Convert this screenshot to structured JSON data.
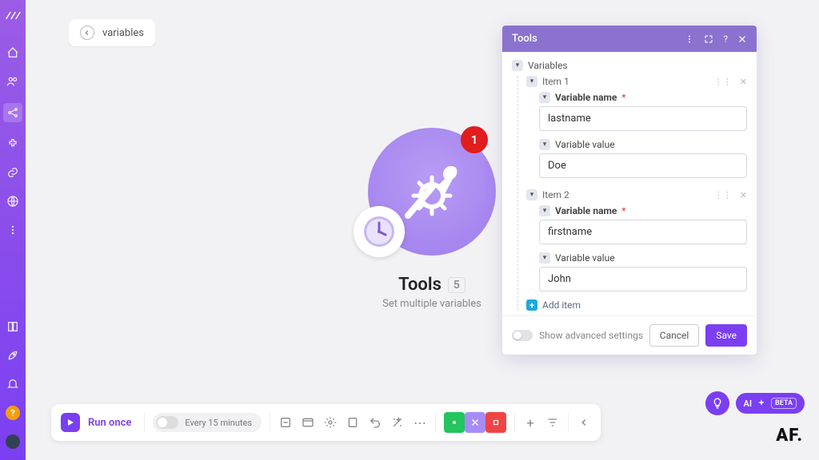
{
  "breadcrumb": {
    "label": "variables"
  },
  "module": {
    "title": "Tools",
    "count": "5",
    "subtitle": "Set multiple variables",
    "badge": "1"
  },
  "panel": {
    "title": "Tools",
    "sections_label": "Variables",
    "items": [
      {
        "label": "Item 1",
        "name_label": "Variable name",
        "name_value": "lastname",
        "value_label": "Variable value",
        "value_value": "Doe"
      },
      {
        "label": "Item 2",
        "name_label": "Variable name",
        "name_value": "firstname",
        "value_label": "Variable value",
        "value_value": "John"
      }
    ],
    "add_item": "Add item",
    "advanced": "Show advanced settings",
    "cancel": "Cancel",
    "save": "Save"
  },
  "toolbar": {
    "run": "Run once",
    "schedule": "Every 15 minutes"
  },
  "ai": {
    "label": "AI",
    "beta": "BETA"
  },
  "brand": "AF."
}
